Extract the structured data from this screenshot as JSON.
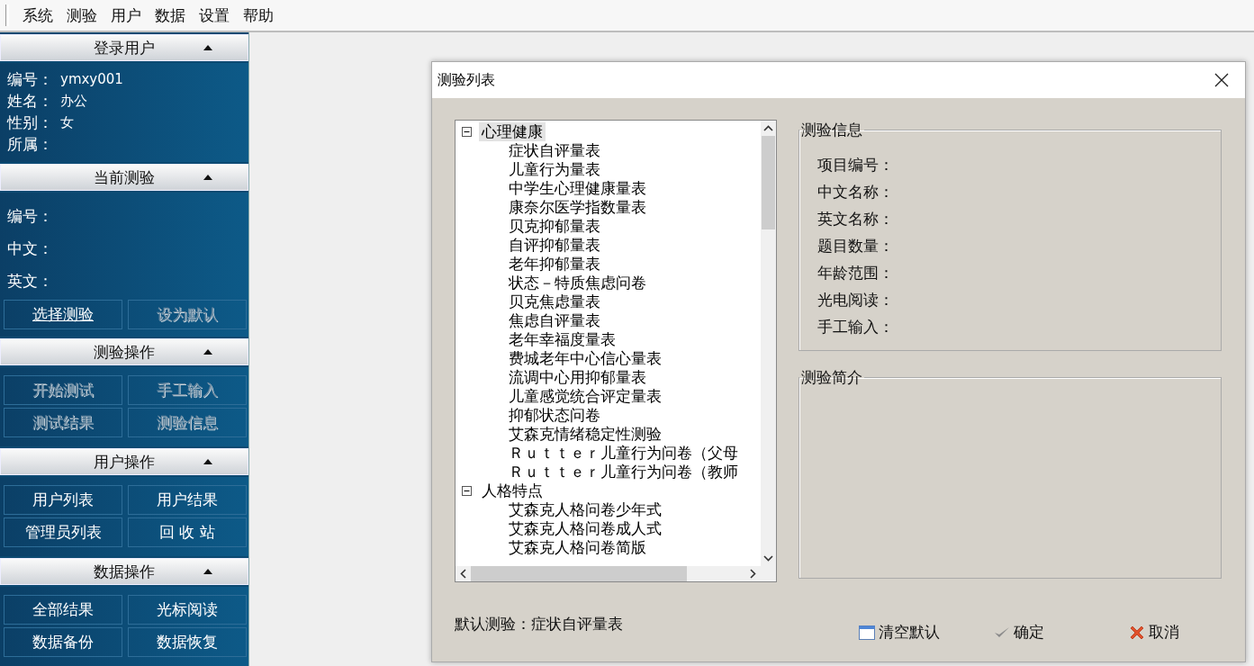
{
  "menu": [
    {
      "label": "系统"
    },
    {
      "label": "测验"
    },
    {
      "label": "用户"
    },
    {
      "label": "数据"
    },
    {
      "label": "设置"
    },
    {
      "label": "帮助"
    }
  ],
  "sidebar": {
    "sections": [
      {
        "title": "登录用户",
        "expanded": true,
        "kind": "compact",
        "fields": [
          {
            "label": "编号：",
            "value": "ymxy001"
          },
          {
            "label": "姓名：",
            "value": "办公"
          },
          {
            "label": "性别：",
            "value": "女"
          },
          {
            "label": "所属："
          }
        ]
      },
      {
        "title": "当前测验",
        "expanded": true,
        "kind": "spaced",
        "fields": [
          {
            "label": "编号："
          },
          {
            "label": "中文："
          },
          {
            "label": "英文："
          }
        ],
        "buttons": [
          {
            "label": "选择测验",
            "disabled": false,
            "underlined": true
          },
          {
            "label": "设为默认",
            "disabled": true,
            "underlined": false
          }
        ]
      },
      {
        "title": "测验操作",
        "expanded": true,
        "kind": "buttons",
        "buttons": [
          {
            "label": "开始测试",
            "disabled": true,
            "underlined": false
          },
          {
            "label": "手工输入",
            "disabled": true,
            "underlined": false
          },
          {
            "label": "测试结果",
            "disabled": true,
            "underlined": false
          },
          {
            "label": "测验信息",
            "disabled": true,
            "underlined": false
          }
        ]
      },
      {
        "title": "用户操作",
        "expanded": true,
        "kind": "buttons",
        "buttons": [
          {
            "label": "用户列表",
            "disabled": false,
            "underlined": false
          },
          {
            "label": "用户结果",
            "disabled": false,
            "underlined": false
          },
          {
            "label": "管理员列表",
            "disabled": false,
            "underlined": false
          },
          {
            "label": "回 收 站",
            "disabled": false,
            "underlined": false
          }
        ]
      },
      {
        "title": "数据操作",
        "expanded": true,
        "kind": "buttons",
        "buttons": [
          {
            "label": "全部结果",
            "disabled": false,
            "underlined": false
          },
          {
            "label": "光标阅读",
            "disabled": false,
            "underlined": false
          },
          {
            "label": "数据备份",
            "disabled": false,
            "underlined": false
          },
          {
            "label": "数据恢复",
            "disabled": false,
            "underlined": false
          }
        ]
      }
    ]
  },
  "dialog": {
    "title": "测验列表",
    "tree": [
      {
        "label": "心理健康",
        "expanded": true,
        "selected": true,
        "children": [
          {
            "label": "症状自评量表"
          },
          {
            "label": "儿童行为量表"
          },
          {
            "label": "中学生心理健康量表"
          },
          {
            "label": "康奈尔医学指数量表"
          },
          {
            "label": "贝克抑郁量表"
          },
          {
            "label": "自评抑郁量表"
          },
          {
            "label": "老年抑郁量表"
          },
          {
            "label": "状态－特质焦虑问卷"
          },
          {
            "label": "贝克焦虑量表"
          },
          {
            "label": "焦虑自评量表"
          },
          {
            "label": "老年幸福度量表"
          },
          {
            "label": "费城老年中心信心量表"
          },
          {
            "label": "流调中心用抑郁量表"
          },
          {
            "label": "儿童感觉统合评定量表"
          },
          {
            "label": "抑郁状态问卷"
          },
          {
            "label": "艾森克情绪稳定性测验"
          },
          {
            "label": "Ｒｕｔｔｅｒ儿童行为问卷（父母"
          },
          {
            "label": "Ｒｕｔｔｅｒ儿童行为问卷（教师"
          }
        ]
      },
      {
        "label": "人格特点",
        "expanded": true,
        "selected": false,
        "children": [
          {
            "label": "艾森克人格问卷少年式"
          },
          {
            "label": "艾森克人格问卷成人式"
          },
          {
            "label": "艾森克人格问卷简版"
          }
        ]
      }
    ],
    "info": {
      "title": "测验信息",
      "fields": [
        {
          "label": "项目编号："
        },
        {
          "label": "中文名称："
        },
        {
          "label": "英文名称："
        },
        {
          "label": "题目数量："
        },
        {
          "label": "年龄范围："
        },
        {
          "label": "光电阅读："
        },
        {
          "label": "手工输入："
        }
      ]
    },
    "intro": {
      "title": "测验简介"
    },
    "default_test": "默认测验：症状自评量表",
    "buttons": [
      {
        "label": "清空默认",
        "kind": "clear"
      },
      {
        "label": "确定",
        "kind": "ok"
      },
      {
        "label": "取消",
        "kind": "cancel"
      }
    ]
  }
}
